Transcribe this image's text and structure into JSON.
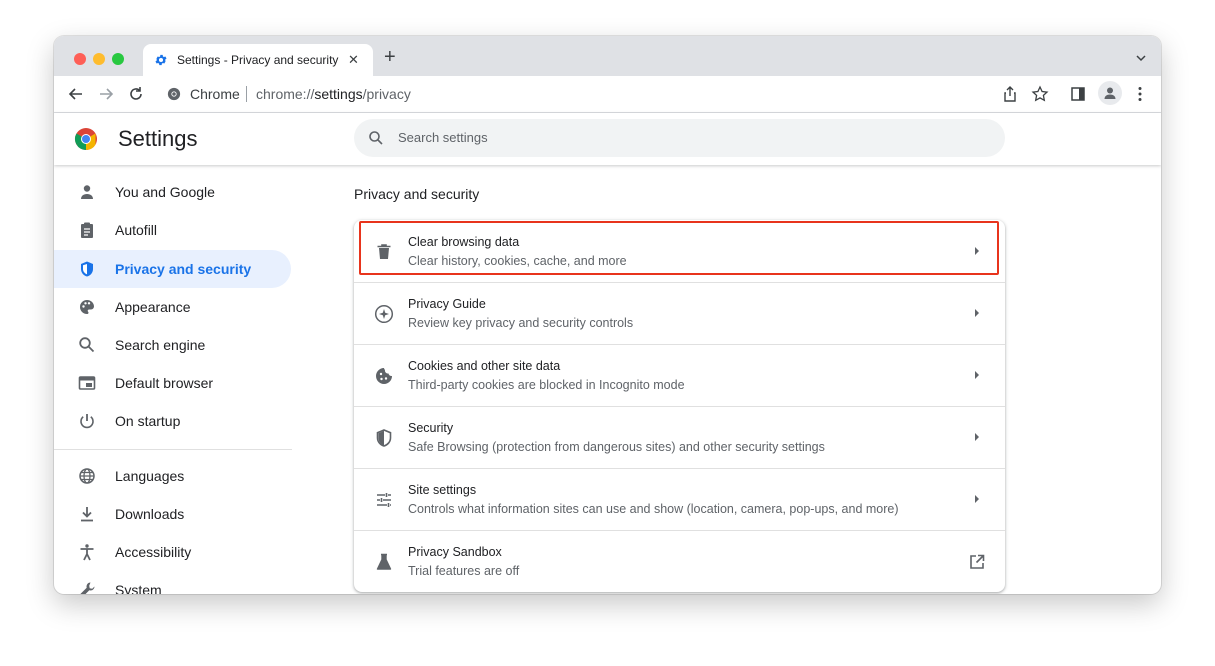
{
  "tab": {
    "title": "Settings - Privacy and security",
    "close": "✕"
  },
  "toolbar": {
    "new_tab": "+"
  },
  "omnibox": {
    "site_label": "Chrome",
    "url_prefix": "chrome://",
    "url_host": "settings",
    "url_path": "/privacy"
  },
  "header": {
    "title": "Settings",
    "search_placeholder": "Search settings"
  },
  "sidebar": {
    "items": [
      {
        "label": "You and Google",
        "icon": "person-icon",
        "active": false
      },
      {
        "label": "Autofill",
        "icon": "clipboard-icon",
        "active": false
      },
      {
        "label": "Privacy and security",
        "icon": "shield-icon",
        "active": true
      },
      {
        "label": "Appearance",
        "icon": "palette-icon",
        "active": false
      },
      {
        "label": "Search engine",
        "icon": "search-icon",
        "active": false
      },
      {
        "label": "Default browser",
        "icon": "browser-icon",
        "active": false
      },
      {
        "label": "On startup",
        "icon": "power-icon",
        "active": false
      },
      {
        "label": "Languages",
        "icon": "globe-icon",
        "active": false
      },
      {
        "label": "Downloads",
        "icon": "download-icon",
        "active": false
      },
      {
        "label": "Accessibility",
        "icon": "accessibility-icon",
        "active": false
      },
      {
        "label": "System",
        "icon": "wrench-icon",
        "active": false
      }
    ]
  },
  "main": {
    "section_title": "Privacy and security",
    "rows": [
      {
        "title": "Clear browsing data",
        "subtitle": "Clear history, cookies, cache, and more",
        "icon": "trash-icon",
        "highlighted": true
      },
      {
        "title": "Privacy Guide",
        "subtitle": "Review key privacy and security controls",
        "icon": "compass-icon"
      },
      {
        "title": "Cookies and other site data",
        "subtitle": "Third-party cookies are blocked in Incognito mode",
        "icon": "cookie-icon"
      },
      {
        "title": "Security",
        "subtitle": "Safe Browsing (protection from dangerous sites) and other security settings",
        "icon": "shield-icon"
      },
      {
        "title": "Site settings",
        "subtitle": "Controls what information sites can use and show (location, camera, pop-ups, and more)",
        "icon": "sliders-icon"
      },
      {
        "title": "Privacy Sandbox",
        "subtitle": "Trial features are off",
        "icon": "flask-icon",
        "external": true
      }
    ]
  },
  "colors": {
    "accent": "#1a73e8",
    "highlight": "#e8341c",
    "active_bg": "#e8f0fe"
  }
}
